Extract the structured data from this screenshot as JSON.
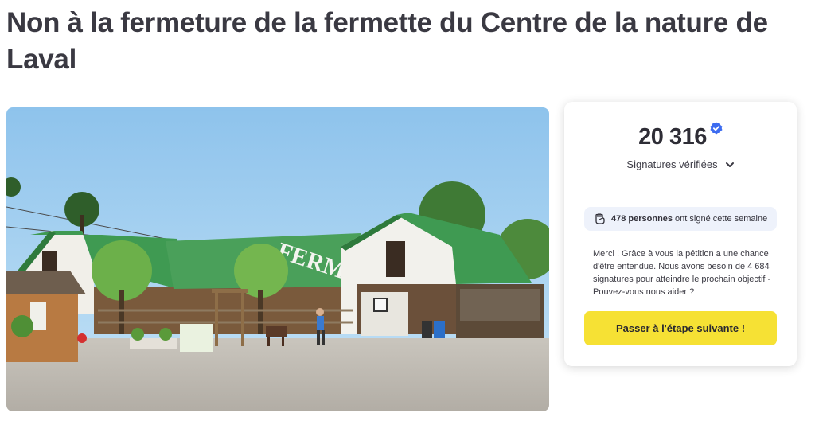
{
  "petition": {
    "title": "Non à la fermeture de la fermette du Centre de la nature de Laval",
    "image_sign_text": "FERME"
  },
  "signatures": {
    "count": "20 316",
    "label": "Signatures vérifiées",
    "verified_icon": "verified-check-icon",
    "expand_icon": "chevron-down-icon"
  },
  "weekly": {
    "icon": "raised-fist-icon",
    "count_text": "478 personnes",
    "rest_text": "ont signé cette semaine"
  },
  "message": "Merci ! Grâce à vous la pétition a une chance d'être entendue. Nous avons besoin de 4 684 signatures pour atteindre le prochain objectif - Pouvez-vous nous aider ?",
  "cta": {
    "label": "Passer à l'étape suivante !"
  },
  "colors": {
    "accent_yellow": "#f6e134",
    "verified_blue": "#3d6cf0",
    "badge_bg": "#eef2fb",
    "roof_green": "#3f9a52"
  }
}
